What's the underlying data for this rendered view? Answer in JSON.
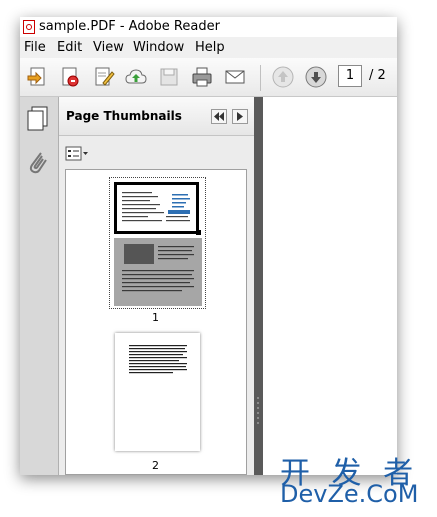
{
  "window": {
    "title": "sample.PDF - Adobe Reader"
  },
  "menu": [
    "File",
    "Edit",
    "View",
    "Window",
    "Help"
  ],
  "toolbar": {
    "current_page": "1",
    "total_pages": "/ 2"
  },
  "panel": {
    "title": "Page Thumbnails"
  },
  "thumbnails": [
    {
      "label": "1"
    },
    {
      "label": "2"
    }
  ],
  "watermark": {
    "line1": "开 发 者",
    "line2": "DevZe.CoM"
  }
}
